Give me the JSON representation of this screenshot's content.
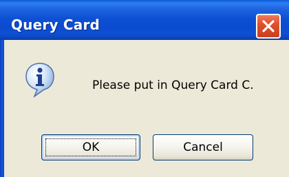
{
  "dialog": {
    "title": "Query Card",
    "message": "Please put in Query Card C.",
    "icon": "info-icon"
  },
  "buttons": {
    "ok_label": "OK",
    "cancel_label": "Cancel"
  },
  "colors": {
    "titlebar": "#0b4bd0",
    "body": "#ece9d8",
    "close_button": "#e0502c"
  }
}
